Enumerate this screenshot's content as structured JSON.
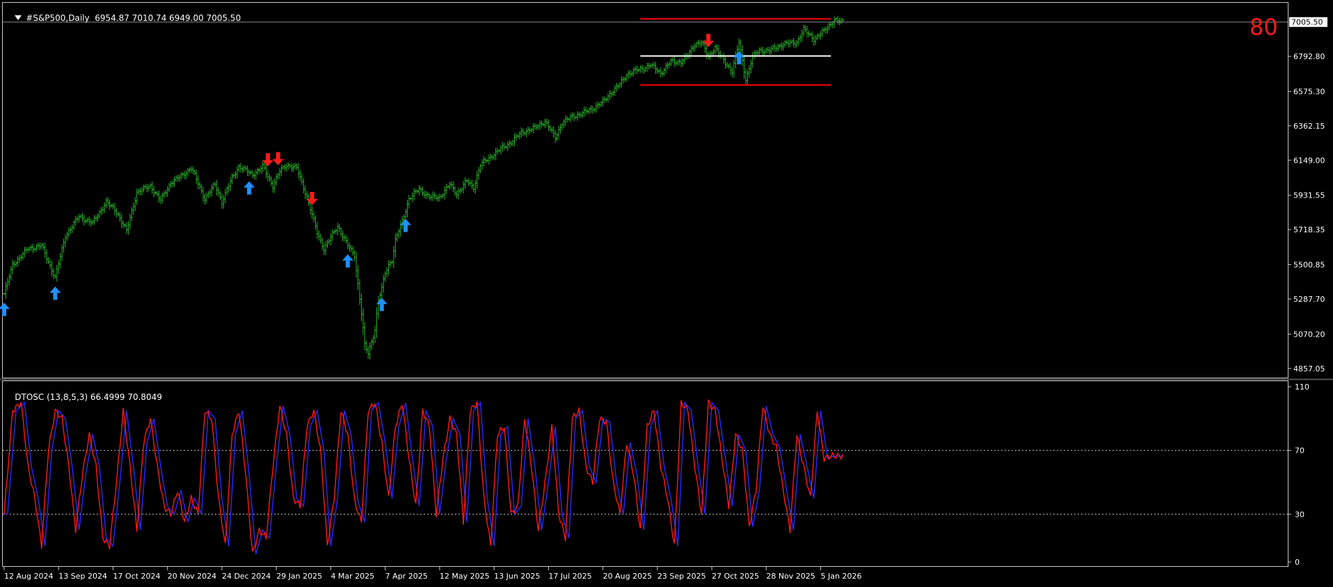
{
  "header": {
    "symbol": "#S&P500,Daily",
    "ohlc": "6954.87 7010.74 6949.00 7005.50"
  },
  "overlay_text": "80",
  "colors": {
    "background": "#000000",
    "bars": "#2db52d",
    "up_arrow": "#1e90ff",
    "down_arrow": "#ff1a1a",
    "level_red": "#ff0000",
    "level_white": "#ffffff",
    "osc_main": "#ff1a1a",
    "osc_signal": "#2a2aff",
    "grid_dotted": "#c8c8c8",
    "price_marker_bg": "#ffffff"
  },
  "chart_data": [
    {
      "type": "ohlc",
      "title": "#S&P500,Daily",
      "price_label": "7005.50",
      "y_ticks": [
        "6792.80",
        "6575.30",
        "6362.15",
        "6149.00",
        "5931.55",
        "5718.35",
        "5500.85",
        "5287.70",
        "5070.20",
        "4857.05"
      ],
      "y_tick_values": [
        6792.8,
        6575.3,
        6362.15,
        6149.0,
        5931.55,
        5718.35,
        5500.85,
        5287.7,
        5070.2,
        4857.05
      ],
      "ylim": [
        4800,
        7125
      ],
      "x_ticks": [
        "12 Aug 2024",
        "13 Sep 2024",
        "17 Oct 2024",
        "20 Nov 2024",
        "24 Dec 2024",
        "29 Jan 2025",
        "4 Mar 2025",
        "7 Apr 2025",
        "12 May 2025",
        "13 Jun 2025",
        "17 Jul 2025",
        "20 Aug 2025",
        "23 Sep 2025",
        "27 Oct 2025",
        "28 Nov 2025",
        "5 Jan 2026"
      ],
      "x_tick_index": [
        0,
        32,
        64,
        96,
        128,
        160,
        192,
        224,
        256,
        288,
        320,
        352,
        384,
        416,
        448,
        480
      ],
      "n_bars": 494,
      "close_anchors": {
        "index": [
          0,
          5,
          14,
          22,
          30,
          36,
          44,
          52,
          60,
          66,
          72,
          78,
          86,
          92,
          98,
          104,
          110,
          118,
          124,
          128,
          134,
          138,
          146,
          150,
          152,
          158,
          162,
          166,
          172,
          178,
          184,
          188,
          196,
          202,
          206,
          210,
          212,
          214,
          218,
          220,
          222,
          224,
          226,
          228,
          230,
          234,
          238,
          244,
          250,
          256,
          262,
          266,
          272,
          276,
          280,
          286,
          292,
          298,
          304,
          312,
          318,
          324,
          328,
          334,
          340,
          346,
          352,
          356,
          362,
          366,
          370,
          376,
          380,
          386,
          392,
          398,
          402,
          406,
          410,
          414,
          418,
          422,
          428,
          432,
          436,
          440,
          444,
          450,
          458,
          466,
          470,
          476,
          482,
          488,
          493
        ],
        "value": [
          5320,
          5500,
          5600,
          5620,
          5420,
          5680,
          5800,
          5760,
          5890,
          5830,
          5710,
          5950,
          5990,
          5900,
          6010,
          6050,
          6100,
          5910,
          6000,
          5890,
          6040,
          6110,
          6060,
          6090,
          6110,
          5990,
          6080,
          6120,
          6100,
          5920,
          5700,
          5600,
          5740,
          5620,
          5560,
          5200,
          5000,
          4950,
          5100,
          5280,
          5350,
          5450,
          5500,
          5530,
          5650,
          5770,
          5910,
          5970,
          5920,
          5920,
          6000,
          5940,
          6020,
          5980,
          6120,
          6170,
          6220,
          6260,
          6320,
          6350,
          6390,
          6290,
          6380,
          6420,
          6440,
          6470,
          6510,
          6560,
          6620,
          6680,
          6700,
          6720,
          6740,
          6690,
          6760,
          6760,
          6800,
          6870,
          6880,
          6790,
          6850,
          6780,
          6700,
          6880,
          6650,
          6790,
          6830,
          6830,
          6870,
          6880,
          6960,
          6900,
          6950,
          7020,
          7005
        ]
      },
      "up_arrows_at": [
        0,
        30,
        144,
        202,
        222,
        236,
        432
      ],
      "down_arrows_at": [
        155,
        161,
        181,
        414
      ],
      "levels": [
        {
          "value": 7025,
          "color": "red",
          "from_index": 374,
          "to_index": 486
        },
        {
          "value": 6795,
          "color": "white",
          "from_index": 374,
          "to_index": 486
        },
        {
          "value": 6615,
          "color": "red",
          "from_index": 374,
          "to_index": 486
        }
      ]
    },
    {
      "type": "line",
      "title": "DTOSC (13,8,5,3) 66.4999 70.8049",
      "series": [
        {
          "name": "66.4999",
          "color": "#ff1a1a"
        },
        {
          "name": "70.8049",
          "color": "#2a2aff"
        }
      ],
      "y_ticks": [
        "110",
        "70",
        "30",
        "0"
      ],
      "y_tick_values": [
        110,
        70,
        30,
        0
      ],
      "ylim": [
        0,
        110
      ],
      "dotted_levels": [
        70,
        30
      ],
      "anchors": {
        "index": [
          0,
          5,
          10,
          14,
          18,
          22,
          26,
          30,
          34,
          38,
          42,
          46,
          50,
          54,
          58,
          62,
          66,
          70,
          74,
          78,
          82,
          86,
          90,
          94,
          98,
          102,
          106,
          110,
          114,
          118,
          122,
          126,
          130,
          134,
          138,
          142,
          146,
          150,
          154,
          158,
          162,
          166,
          170,
          174,
          178,
          182,
          186,
          190,
          194,
          198,
          202,
          206,
          210,
          214,
          218,
          222,
          226,
          230,
          234,
          238,
          242,
          246,
          250,
          254,
          258,
          262,
          266,
          270,
          274,
          278,
          282,
          286,
          290,
          294,
          298,
          302,
          306,
          310,
          314,
          318,
          322,
          326,
          330,
          334,
          338,
          342,
          346,
          350,
          354,
          358,
          362,
          366,
          370,
          374,
          378,
          382,
          386,
          390,
          394,
          398,
          402,
          406,
          410,
          414,
          418,
          422,
          426,
          430,
          434,
          438,
          442,
          446,
          450,
          454,
          458,
          462,
          466,
          470,
          474,
          478,
          482,
          486
        ],
        "value": [
          30,
          95,
          100,
          60,
          40,
          10,
          70,
          95,
          90,
          60,
          20,
          55,
          80,
          60,
          15,
          10,
          50,
          95,
          60,
          20,
          75,
          90,
          60,
          35,
          30,
          45,
          25,
          40,
          30,
          95,
          90,
          40,
          10,
          80,
          95,
          55,
          5,
          20,
          15,
          60,
          98,
          80,
          40,
          35,
          85,
          95,
          70,
          10,
          40,
          95,
          80,
          38,
          25,
          95,
          100,
          75,
          40,
          85,
          100,
          65,
          35,
          95,
          85,
          30,
          65,
          90,
          80,
          25,
          95,
          100,
          40,
          10,
          80,
          85,
          30,
          35,
          90,
          60,
          20,
          50,
          85,
          30,
          15,
          90,
          95,
          60,
          50,
          90,
          88,
          50,
          30,
          75,
          55,
          20,
          85,
          95,
          60,
          40,
          10,
          100,
          95,
          60,
          30,
          100,
          95,
          65,
          35,
          80,
          70,
          22,
          45,
          98,
          80,
          72,
          45,
          20,
          80,
          60,
          40,
          95,
          65,
          66.5
        ],
        "signal_lag_bars": 2
      }
    }
  ]
}
